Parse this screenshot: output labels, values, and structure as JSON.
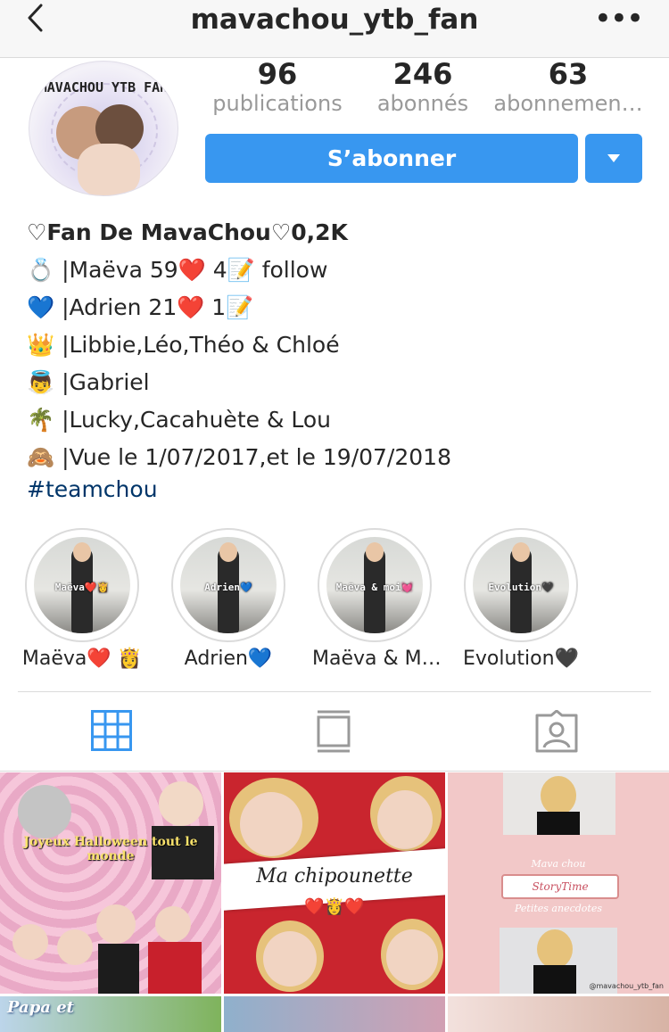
{
  "header": {
    "title": "mavachou_ytb_fan",
    "back_icon": "chevron-left-icon",
    "more_icon": "more-horizontal-icon"
  },
  "avatar": {
    "text": "MAVACHOU YTB FAN"
  },
  "stats": [
    {
      "value": "96",
      "label": "publications"
    },
    {
      "value": "246",
      "label": "abonnés"
    },
    {
      "value": "63",
      "label": "abonnemen…"
    }
  ],
  "actions": {
    "follow_label": "S’abonner",
    "accent": "#3897f0"
  },
  "bio": {
    "name": "♡Fan De MavaChou♡0,2K",
    "lines": [
      "💍 |Maëva 59❤️  4📝  follow",
      "💙 |Adrien 21❤️  1📝",
      "👑 |Libbie,Léo,Théo & Chloé",
      "👼 |Gabriel",
      "🌴 |Lucky,Cacahuète & Lou",
      "🙈 |Vue le 1/07/2017,et le 19/07/2018"
    ],
    "hashtag": "#teamchou",
    "hashtag_color": "#003569"
  },
  "highlights": [
    {
      "label": "Maëva❤️ 👸",
      "cover_text": "Maëva❤️👸"
    },
    {
      "label": "Adrien💙",
      "cover_text": "Adrien💙"
    },
    {
      "label": "Maëva & M…",
      "cover_text": "Maëva & moi💓"
    },
    {
      "label": "Evolution🖤",
      "cover_text": "Evolution🖤"
    }
  ],
  "tabs": [
    {
      "name": "grid",
      "icon": "grid-icon",
      "active": true
    },
    {
      "name": "feed",
      "icon": "feed-icon",
      "active": false
    },
    {
      "name": "tagged",
      "icon": "tagged-icon",
      "active": false
    }
  ],
  "posts": {
    "halloween": "Joyeux Halloween tout le monde",
    "chipounette": "Ma chipounette",
    "chipounette_emojis": "❤️👸❤️",
    "story_top": "Mava chou",
    "story_ribbon": "StoryTime",
    "story_sub": "Petites anecdotes",
    "watermark": "@mavachou_ytb_fan",
    "partial": "Papa et"
  }
}
